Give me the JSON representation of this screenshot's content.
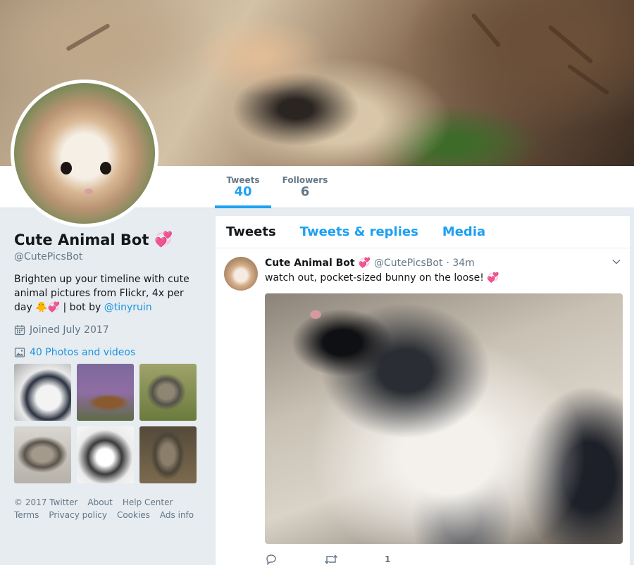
{
  "nav": {
    "tweets_label": "Tweets",
    "tweets_count": "40",
    "followers_label": "Followers",
    "followers_count": "6"
  },
  "profile": {
    "name": "Cute Animal Bot",
    "name_emoji": "💞",
    "handle": "@CutePicsBot",
    "bio_text": "Brighten up your timeline with cute animal pictures from Flickr, 4x per day 🐥💞 | bot by ",
    "bio_link": "@tinyruin",
    "joined": "Joined July 2017",
    "photos_link": "40 Photos and videos"
  },
  "footer": {
    "links": [
      "© 2017 Twitter",
      "About",
      "Help Center",
      "Terms",
      "Privacy policy",
      "Cookies",
      "Ads info"
    ]
  },
  "tabs": [
    "Tweets",
    "Tweets & replies",
    "Media"
  ],
  "tweet": {
    "name": "Cute Animal Bot",
    "name_emoji": "💞",
    "handle": "@CutePicsBot",
    "time": "· 34m",
    "text": "watch out, pocket-sized bunny on the loose! 💞",
    "like_count": "1"
  },
  "icons": {
    "calendar": "calendar-icon",
    "photos": "image-icon",
    "reply": "reply-icon",
    "retweet": "retweet-icon",
    "like": "heart-icon",
    "caret": "chevron-down-icon"
  },
  "colors": {
    "accent": "#1da1f2",
    "link": "#1b95e0",
    "muted": "#657786",
    "background": "#e6ecf0"
  }
}
